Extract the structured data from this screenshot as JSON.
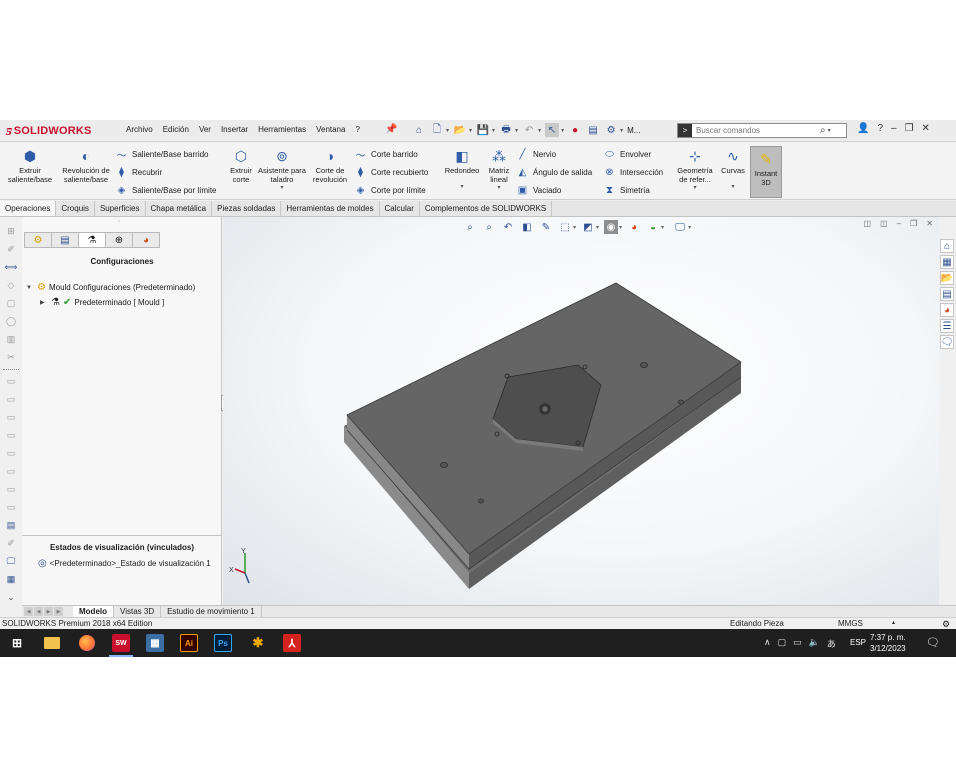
{
  "app": {
    "logo_ds": "3DS",
    "logo_text": "SOLIDWORKS",
    "menu": [
      "Archivo",
      "Edición",
      "Ver",
      "Insertar",
      "Herramientas",
      "Ventana",
      "?"
    ],
    "quick_more": "M...",
    "search_placeholder": "Buscar comandos"
  },
  "ribbon": {
    "extruir_saliente": "Extruir saliente/base",
    "revolucion_saliente": "Revolución de saliente/base",
    "saliente_barrido": "Saliente/Base barrido",
    "recubrir": "Recubrir",
    "saliente_limite": "Saliente/Base por límite",
    "extruir_corte": "Extruir corte",
    "asistente_taladro": "Asistente para taladro",
    "corte_revolucion": "Corte de revolución",
    "corte_barrido": "Corte barrido",
    "corte_recubierto": "Corte recubierto",
    "corte_limite": "Corte por límite",
    "redondeo": "Redondeo",
    "matriz_lineal": "Matriz lineal",
    "nervio": "Nervio",
    "angulo_salida": "Ángulo de salida",
    "vaciado": "Vaciado",
    "envolver": "Envolver",
    "interseccion": "Intersección",
    "simetria": "Simetría",
    "geometria_ref": "Geometría de refer...",
    "curvas": "Curvas",
    "instant3d": "Instant 3D"
  },
  "command_tabs": [
    "Operaciones",
    "Croquis",
    "Superficies",
    "Chapa metálica",
    "Piezas soldadas",
    "Herramientas de moldes",
    "Calcular",
    "Complementos de SOLIDWORKS"
  ],
  "feature_manager": {
    "title": "Configuraciones",
    "root": "Mould Configuraciones  (Predeterminado)",
    "child": "Predeterminado [ Mould ]",
    "display_states_title": "Estados de visualización (vinculados)",
    "display_state": "<Predeterminado>_Estado de visualización 1"
  },
  "bottom_tabs": [
    "Modelo",
    "Vistas 3D",
    "Estudio de movimiento 1"
  ],
  "status": {
    "edition": "SOLIDWORKS Premium 2018 x64 Edition",
    "mode": "Editando Pieza",
    "units": "MMGS"
  },
  "triad": {
    "x": "X",
    "y": "Y"
  },
  "taskbar": {
    "apps": [
      {
        "name": "file-explorer",
        "label": "",
        "color": "#f2c14e"
      },
      {
        "name": "firefox",
        "label": "",
        "color": "#ff7139"
      },
      {
        "name": "solidworks",
        "label": "SW",
        "color": "#c8102e"
      },
      {
        "name": "calculator",
        "label": "",
        "color": "#3a6ea5"
      },
      {
        "name": "illustrator",
        "label": "Ai",
        "color": "#ff9a00"
      },
      {
        "name": "photoshop",
        "label": "Ps",
        "color": "#31a8ff"
      },
      {
        "name": "solidworks-2",
        "label": "",
        "color": "#c8102e"
      },
      {
        "name": "acrobat",
        "label": "",
        "color": "#d4221f"
      }
    ],
    "language": "ESP",
    "time": "7:37 p. m.",
    "date": "3/12/2023"
  }
}
